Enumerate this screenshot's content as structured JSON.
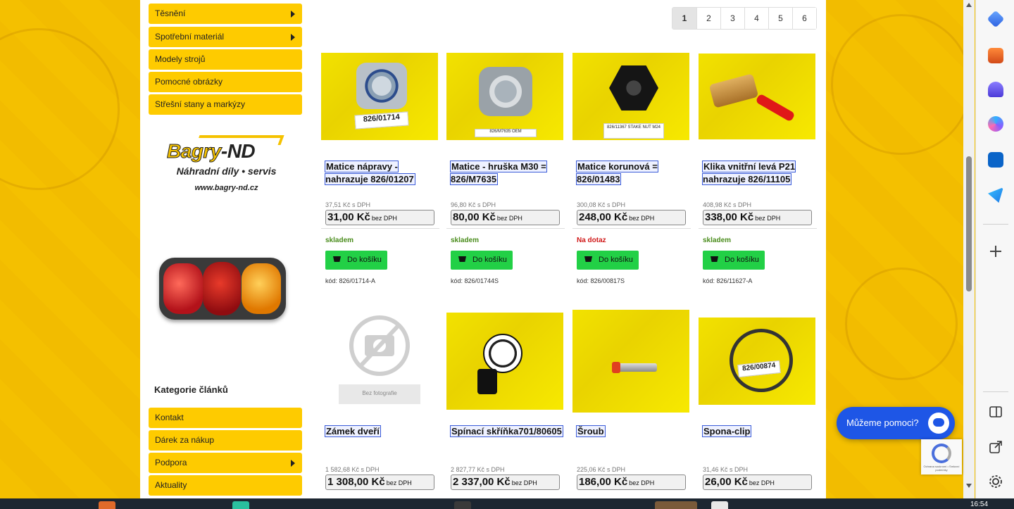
{
  "sidebar": {
    "menu_top": [
      {
        "label": "Těsnění",
        "has_submenu": true
      },
      {
        "label": "Spotřební materiál",
        "has_submenu": true
      },
      {
        "label": "Modely strojů",
        "has_submenu": false
      },
      {
        "label": "Pomocné obrázky",
        "has_submenu": false
      },
      {
        "label": "Střešní stany a markýzy",
        "has_submenu": false
      }
    ],
    "logo": {
      "brand_left": "Bagry",
      "brand_right": "-ND",
      "tagline": "Náhradní díly • servis",
      "url": "www.bagry-nd.cz"
    },
    "articles_heading": "Kategorie článků",
    "menu_articles": [
      {
        "label": "Kontakt",
        "has_submenu": false
      },
      {
        "label": "Dárek za nákup",
        "has_submenu": false
      },
      {
        "label": "Podpora",
        "has_submenu": true
      },
      {
        "label": "Aktuality",
        "has_submenu": false
      }
    ]
  },
  "pagination": {
    "pages": [
      "1",
      "2",
      "3",
      "4",
      "5",
      "6"
    ],
    "current": "1"
  },
  "products": [
    {
      "name": "Matice nápravy - nahrazuje 826/01207",
      "price_vat": "37,51 Kč s DPH",
      "price": "31,00 Kč",
      "price_suffix": "bez DPH",
      "stock": "skladem",
      "stock_status": "ok",
      "cart_label": "Do košíku",
      "code": "kód: 826/01714-A",
      "image_label": "826/01714"
    },
    {
      "name": "Matice - hruška M30 = 826/M7635",
      "price_vat": "96,80 Kč s DPH",
      "price": "80,00 Kč",
      "price_suffix": "bez DPH",
      "stock": "skladem",
      "stock_status": "ok",
      "cart_label": "Do košíku",
      "code": "kód: 826/01744S",
      "image_label": "826/M7635 OEM"
    },
    {
      "name": "Matice korunová = 826/01483",
      "price_vat": "300,08 Kč s DPH",
      "price": "248,00 Kč",
      "price_suffix": "bez DPH",
      "stock": "Na dotaz",
      "stock_status": "ask",
      "cart_label": "Do košíku",
      "code": "kód: 826/00817S",
      "image_label": "826/11367 STAKE NUT M24"
    },
    {
      "name": "Klika vnitřní levá P21 nahrazuje 826/11105",
      "price_vat": "408,98 Kč s DPH",
      "price": "338,00 Kč",
      "price_suffix": "bez DPH",
      "stock": "skladem",
      "stock_status": "ok",
      "cart_label": "Do košíku",
      "code": "kód: 826/11627-A",
      "image_label": ""
    },
    {
      "name": "Zámek dveří",
      "price_vat": "1 582,68 Kč s DPH",
      "price": "1 308,00 Kč",
      "price_suffix": "bez DPH",
      "image_label": "Bez fotografie"
    },
    {
      "name": "Spínací skříňka701/80605",
      "price_vat": "2 827,77 Kč s DPH",
      "price": "2 337,00 Kč",
      "price_suffix": "bez DPH",
      "image_label": ""
    },
    {
      "name": "Šroub",
      "price_vat": "225,06 Kč s DPH",
      "price": "186,00 Kč",
      "price_suffix": "bez DPH",
      "image_label": ""
    },
    {
      "name": "Spona-clip",
      "price_vat": "31,46 Kč s DPH",
      "price": "26,00 Kč",
      "price_suffix": "bez DPH",
      "image_label": "826/00874"
    }
  ],
  "help_chat": {
    "label": "Můžeme pomoci?"
  },
  "recaptcha": {
    "text": "Ochrana soukromí • Smluvní podmínky"
  },
  "taskbar": {
    "clock": "16:54"
  },
  "colors": {
    "accent_yellow": "#fecb00",
    "cart_green": "#22d046",
    "link_blue": "#3a5bd8",
    "stock_ok": "#4a8c1c",
    "stock_ask": "#d01818"
  }
}
